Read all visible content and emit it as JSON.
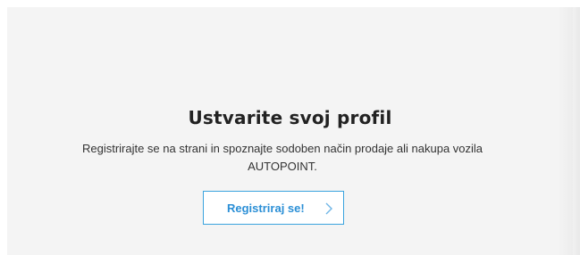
{
  "section": {
    "title": "Ustvarite svoj profil",
    "description": "Registrirajte se na strani in spoznajte sodoben način prodaje ali nakupa vozila AUTOPOINT.",
    "cta_label": "Registriraj se!",
    "cta_icon": "chevron-right-icon"
  },
  "colors": {
    "panel_background": "#f4f4f4",
    "accent": "#2b8fd6",
    "heading": "#222222"
  }
}
